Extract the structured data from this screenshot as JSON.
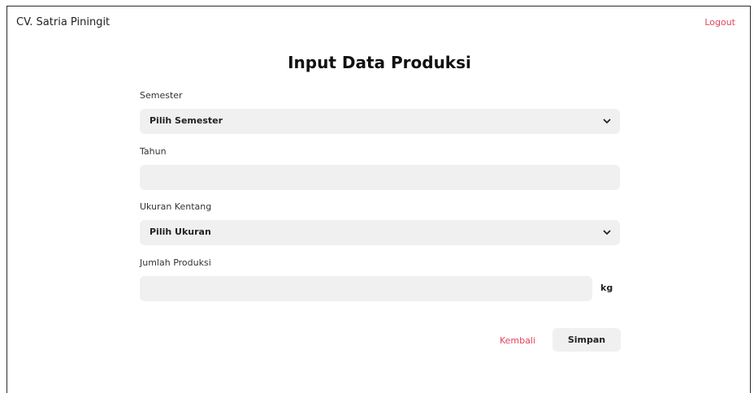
{
  "header": {
    "brand": "CV. Satria Piningit",
    "logout_label": "Logout"
  },
  "form": {
    "title": "Input Data Produksi",
    "semester": {
      "label": "Semester",
      "selected": "Pilih Semester"
    },
    "tahun": {
      "label": "Tahun",
      "value": ""
    },
    "ukuran": {
      "label": "Ukuran Kentang",
      "selected": "Pilih Ukuran"
    },
    "jumlah": {
      "label": "Jumlah Produksi",
      "value": "",
      "unit": "kg"
    },
    "back_label": "Kembali",
    "save_label": "Simpan"
  },
  "colors": {
    "accent": "#e0445a",
    "field_bg": "#f0f0f0"
  },
  "icons": {
    "dropdown": "chevron-down-icon"
  }
}
